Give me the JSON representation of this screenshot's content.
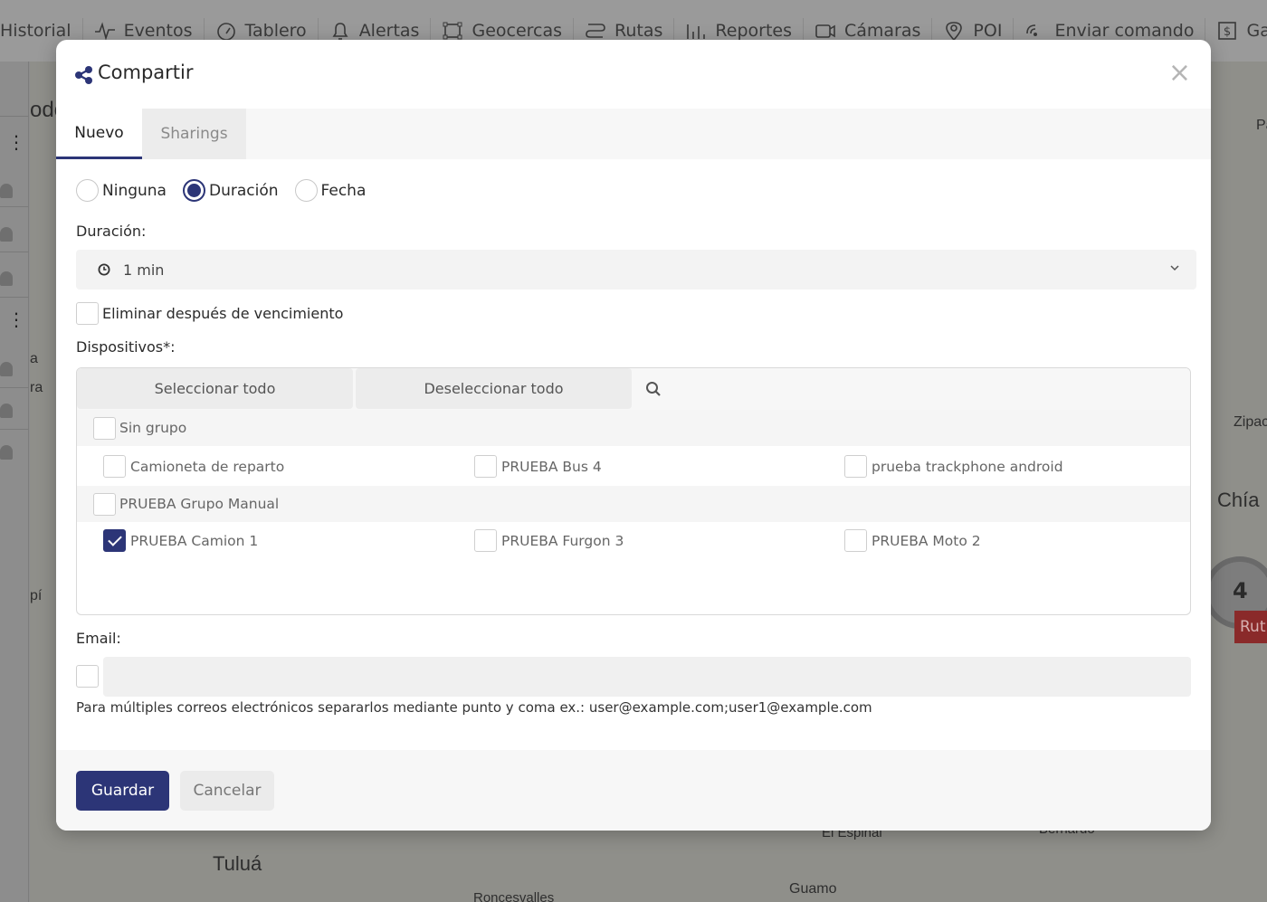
{
  "nav": {
    "items": [
      {
        "label": "Historial",
        "icon": "history-icon"
      },
      {
        "label": "Eventos",
        "icon": "pulse-icon"
      },
      {
        "label": "Tablero",
        "icon": "gauge-icon"
      },
      {
        "label": "Alertas",
        "icon": "bell-icon"
      },
      {
        "label": "Geocercas",
        "icon": "geofence-icon"
      },
      {
        "label": "Rutas",
        "icon": "route-icon"
      },
      {
        "label": "Reportes",
        "icon": "chart-icon"
      },
      {
        "label": "Cámaras",
        "icon": "camera-icon"
      },
      {
        "label": "POI",
        "icon": "pin-icon"
      },
      {
        "label": "Enviar comando",
        "icon": "signal-icon"
      },
      {
        "label": "Gastos",
        "icon": "dollar-icon"
      }
    ]
  },
  "map": {
    "labels": {
      "tulua": "Tuluá",
      "chia": "Chía",
      "zipac": "Zipac",
      "guamo": "Guamo",
      "el_espinal": "El Espinal",
      "roncesvalles": "Roncesvalles",
      "bernardo": "Bernardo",
      "odo": "odó",
      "pa": "Pa",
      "pi": "pí",
      "a": "a",
      "ra": "ra"
    },
    "cluster_count": "4",
    "badge": "Rut"
  },
  "modal": {
    "title": "Compartir",
    "close": "×",
    "tabs": {
      "new": "Nuevo",
      "sharings": "Sharings"
    },
    "radios": {
      "none": "Ninguna",
      "duration": "Duración",
      "date": "Fecha",
      "selected": "Duración"
    },
    "duration_label": "Duración:",
    "duration_value": "1 min",
    "delete_after_label": "Eliminar después de vencimiento",
    "devices_label": "Dispositivos*:",
    "select_all": "Seleccionar todo",
    "deselect_all": "Deseleccionar todo",
    "groups": [
      {
        "name": "Sin grupo",
        "devices": [
          {
            "name": "Camioneta de reparto",
            "checked": false
          },
          {
            "name": "PRUEBA Bus 4",
            "checked": false
          },
          {
            "name": "prueba trackphone android",
            "checked": false
          }
        ]
      },
      {
        "name": "PRUEBA Grupo Manual",
        "devices": [
          {
            "name": "PRUEBA Camion 1",
            "checked": true
          },
          {
            "name": "PRUEBA Furgon 3",
            "checked": false
          },
          {
            "name": "PRUEBA Moto 2",
            "checked": false
          }
        ]
      }
    ],
    "email_label": "Email:",
    "email_value": "",
    "email_hint": "Para múltiples correos electrónicos separarlos mediante punto y coma ex.: user@example.com;user1@example.com",
    "save": "Guardar",
    "cancel": "Cancelar"
  },
  "colors": {
    "primary": "#2c3577"
  }
}
